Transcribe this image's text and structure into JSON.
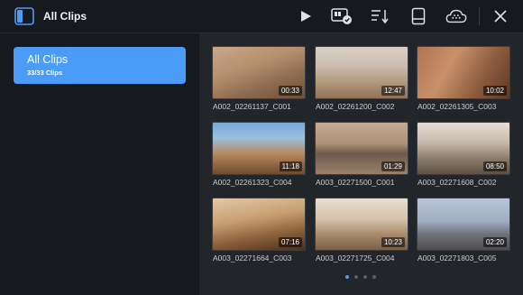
{
  "header": {
    "title": "All Clips",
    "icons": [
      "sidebar-toggle-icon",
      "play-icon",
      "card-reader-icon",
      "sort-icon",
      "drive-icon",
      "cloud-icon",
      "close-icon"
    ]
  },
  "sidebar": {
    "group": {
      "title": "All Clips",
      "count": "33/33 Clips"
    }
  },
  "clips": [
    {
      "name": "A002_02261137_C001",
      "duration": "00:33",
      "bg": "linear-gradient(160deg,#c9a98a 0%,#b48d6d 40%,#8c6a4f 70%,#6e5039 100%)"
    },
    {
      "name": "A002_02261200_C002",
      "duration": "12:47",
      "bg": "linear-gradient(180deg,#d9cfc6 0%,#cbbfb3 35%,#b59c82 65%,#8f7257 100%)"
    },
    {
      "name": "A002_02261305_C003",
      "duration": "10:02",
      "bg": "linear-gradient(120deg,#b07451 0%,#c8906a 35%,#8a5a3d 70%,#5d3a27 100%)"
    },
    {
      "name": "A002_02261323_C004",
      "duration": "11:18",
      "bg": "linear-gradient(180deg,#7aa8d8 0%,#9bbfe0 30%,#b8895f 60%,#6e4a2e 100%)"
    },
    {
      "name": "A003_02271500_C001",
      "duration": "01:29",
      "bg": "linear-gradient(180deg,#c4ab93 0%,#b09275 40%,#6c5a4d 60%,#9a8068 100%)"
    },
    {
      "name": "A003_02271608_C002",
      "duration": "08:50",
      "bg": "linear-gradient(180deg,#e6dfd6 0%,#c4b7a7 40%,#8d7c6a 70%,#5c4f43 100%)"
    },
    {
      "name": "A003_02271664_C003",
      "duration": "07:16",
      "bg": "linear-gradient(170deg,#e2c9a6 0%,#c79e72 40%,#8a5f3b 70%,#4a3020 100%)"
    },
    {
      "name": "A003_02271725_C004",
      "duration": "10:23",
      "bg": "linear-gradient(180deg,#e8ddd0 0%,#d4c2ac 40%,#a88a6b 70%,#7a5f47 100%)"
    },
    {
      "name": "A003_02271803_C005",
      "duration": "02:20",
      "bg": "linear-gradient(180deg,#b9c6d8 0%,#9eadc2 45%,#6f7078 70%,#4f4c4f 100%)"
    }
  ],
  "pager": {
    "count": 4,
    "active": 0
  }
}
